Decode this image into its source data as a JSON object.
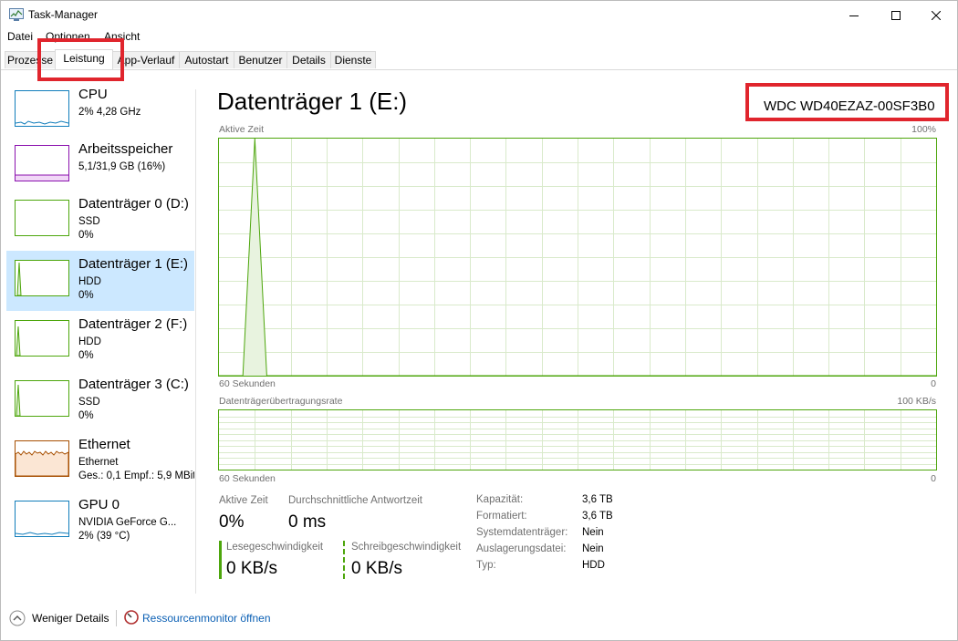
{
  "window": {
    "title": "Task-Manager"
  },
  "menu": [
    "Datei",
    "Optionen",
    "Ansicht"
  ],
  "tabs": [
    {
      "label": "Prozesse",
      "active": false
    },
    {
      "label": "Leistung",
      "active": true
    },
    {
      "label": "App-Verlauf",
      "active": false
    },
    {
      "label": "Autostart",
      "active": false
    },
    {
      "label": "Benutzer",
      "active": false
    },
    {
      "label": "Details",
      "active": false
    },
    {
      "label": "Dienste",
      "active": false
    }
  ],
  "sidebar": [
    {
      "title": "CPU",
      "sub": "2% 4,28 GHz",
      "sub2": "",
      "color": "#117dbb"
    },
    {
      "title": "Arbeitsspeicher",
      "sub": "5,1/31,9 GB (16%)",
      "sub2": "",
      "color": "#8b12ae"
    },
    {
      "title": "Datenträger 0 (D:)",
      "sub": "SSD",
      "sub2": "0%",
      "color": "#4da60c"
    },
    {
      "title": "Datenträger 1 (E:)",
      "sub": "HDD",
      "sub2": "0%",
      "color": "#4da60c"
    },
    {
      "title": "Datenträger 2 (F:)",
      "sub": "HDD",
      "sub2": "0%",
      "color": "#4da60c"
    },
    {
      "title": "Datenträger 3 (C:)",
      "sub": "SSD",
      "sub2": "0%",
      "color": "#4da60c"
    },
    {
      "title": "Ethernet",
      "sub": "Ethernet",
      "sub2": "Ges.: 0,1 Empf.: 5,9 MBit",
      "color": "#a74f01"
    },
    {
      "title": "GPU 0",
      "sub": "NVIDIA GeForce G...",
      "sub2": "2% (39 °C)",
      "color": "#117dbb"
    }
  ],
  "main": {
    "title": "Datenträger 1 (E:)",
    "model": "WDC WD40EZAZ-00SF3B0",
    "chart1": {
      "label": "Aktive Zeit",
      "max": "100%",
      "left": "60 Sekunden",
      "right": "0"
    },
    "chart2": {
      "label": "Datenträgerübertragungsrate",
      "max": "100 KB/s",
      "left": "60 Sekunden",
      "right": "0"
    },
    "stats": {
      "active_time_label": "Aktive Zeit",
      "active_time_value": "0%",
      "response_label": "Durchschnittliche Antwortzeit",
      "response_value": "0 ms",
      "read_label": "Lesegeschwindigkeit",
      "read_value": "0 KB/s",
      "write_label": "Schreibgeschwindigkeit",
      "write_value": "0 KB/s"
    },
    "properties": [
      {
        "key": "Kapazität:",
        "value": "3,6 TB"
      },
      {
        "key": "Formatiert:",
        "value": "3,6 TB"
      },
      {
        "key": "Systemdatenträger:",
        "value": "Nein"
      },
      {
        "key": "Auslagerungsdatei:",
        "value": "Nein"
      },
      {
        "key": "Typ:",
        "value": "HDD"
      }
    ]
  },
  "footer": {
    "fewer_details": "Weniger Details",
    "resource_monitor": "Ressourcenmonitor öffnen"
  },
  "chart_data": {
    "type": "area",
    "title": "Aktive Zeit",
    "xlabel": "60 Sekunden",
    "ylim": [
      0,
      100
    ],
    "x": [
      60,
      58,
      57,
      56,
      55,
      0
    ],
    "values": [
      0,
      0,
      100,
      0,
      0,
      0
    ]
  }
}
